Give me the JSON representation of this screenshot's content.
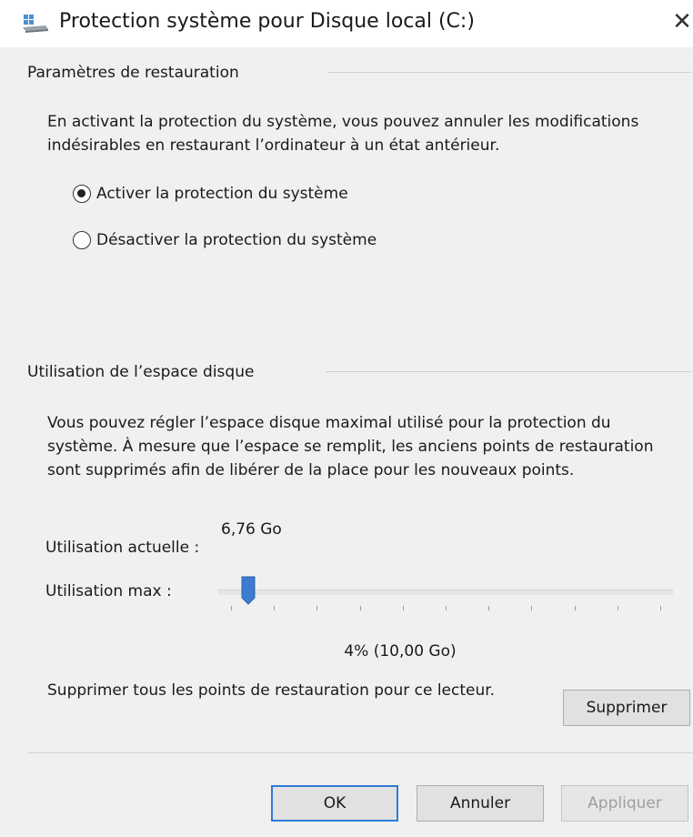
{
  "window": {
    "title": "Protection système pour Disque local (C:)",
    "close_symbol": "✕",
    "icon": "system-protection-icon"
  },
  "restore_settings": {
    "group_label": "Paramètres de restauration",
    "description": "En activant la protection du système, vous pouvez annuler les modifications indésirables en restaurant l’ordinateur à un état antérieur.",
    "options": [
      {
        "label": "Activer la protection du système",
        "selected": true
      },
      {
        "label": "Désactiver la protection du système",
        "selected": false
      }
    ]
  },
  "disk_usage": {
    "group_label": "Utilisation de l’espace disque",
    "description": "Vous pouvez régler l’espace disque maximal utilisé pour la protection du système. À mesure que l’espace se remplit, les anciens points de restauration sont supprimés afin de libérer de la place pour les nouveaux points.",
    "current_label": "Utilisation actuelle :",
    "current_value": "6,76 Go",
    "max_label": "Utilisation max :",
    "max_value_text": "4% (10,00 Go)",
    "slider_percent": 4
  },
  "delete_section": {
    "text": "Supprimer tous les points de restauration pour ce lecteur.",
    "button_label": "Supprimer"
  },
  "footer": {
    "ok_label": "OK",
    "cancel_label": "Annuler",
    "apply_label": "Appliquer"
  },
  "colors": {
    "slider_thumb": "#3b7bd0",
    "default_button_border": "#2e7bd6",
    "panel_background": "#f0f0f0"
  }
}
